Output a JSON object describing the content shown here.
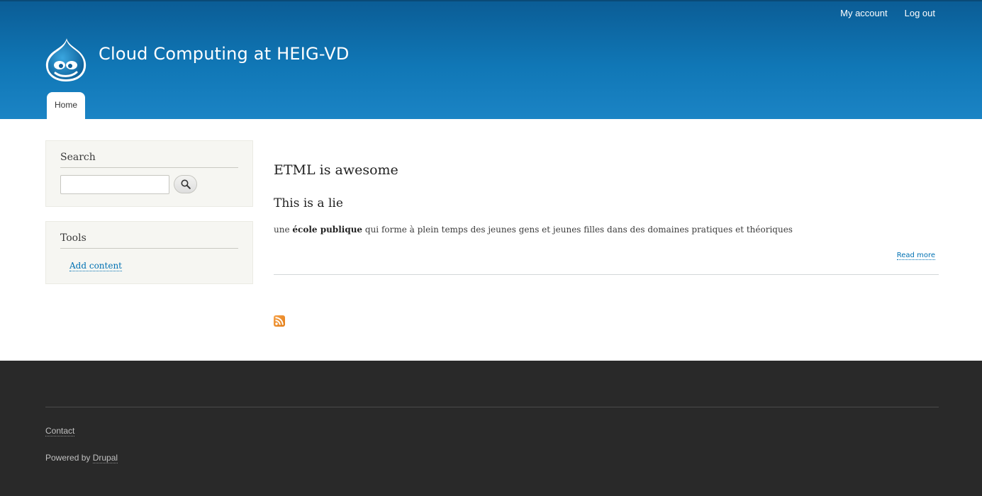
{
  "header": {
    "site_name": "Cloud Computing at HEIG-VD",
    "secondary_menu": {
      "my_account": "My account",
      "log_out": "Log out"
    },
    "main_menu": {
      "home": "Home"
    },
    "logo_icon": "drupal-drop-icon"
  },
  "sidebar": {
    "search": {
      "title": "Search",
      "input_value": "",
      "button_icon": "search-icon"
    },
    "tools": {
      "title": "Tools",
      "links": [
        "Add content"
      ]
    }
  },
  "content": {
    "page_title": "ETML is awesome",
    "node": {
      "title": "This is a lie",
      "body_prefix": "une ",
      "body_bold": "école publique",
      "body_suffix": " qui forme à plein temps des jeunes gens et jeunes filles dans des domaines pratiques et théoriques",
      "read_more": "Read more"
    },
    "feed_icon": "rss-feed-icon"
  },
  "footer": {
    "contact": "Contact",
    "powered_by_prefix": "Powered by ",
    "powered_by_link": "Drupal"
  },
  "colors": {
    "header_top": "#0b5d96",
    "header_bottom": "#1b84c5",
    "link": "#0071b3",
    "footer_bg": "#292929",
    "sidebar_bg": "#f6f6f2"
  }
}
